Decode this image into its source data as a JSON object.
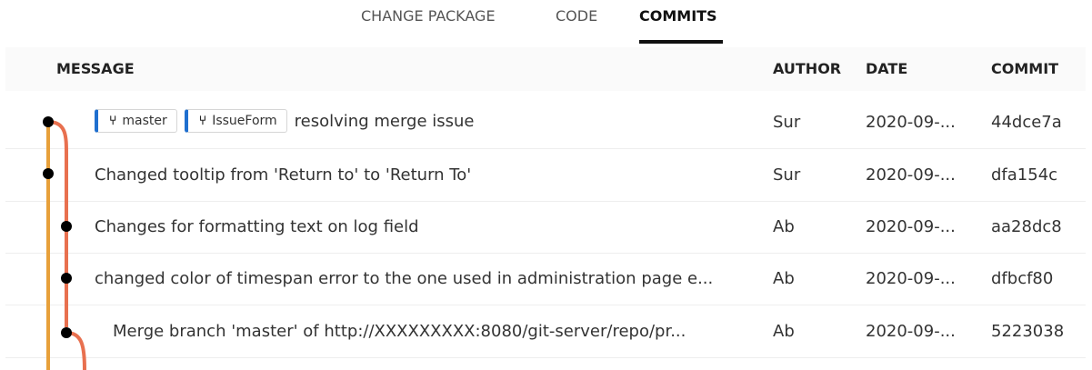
{
  "tabs": [
    {
      "label": "CHANGE PACKAGE",
      "active": false
    },
    {
      "label": "CODE",
      "active": false
    },
    {
      "label": "COMMITS",
      "active": true
    }
  ],
  "columns": {
    "message": "MESSAGE",
    "author": "AUTHOR",
    "date": "DATE",
    "commit": "COMMIT"
  },
  "rows": [
    {
      "refs": [
        {
          "label": "master"
        },
        {
          "label": "IssueForm"
        }
      ],
      "message": "resolving merge issue",
      "author": "Sur",
      "date": "2020-09-...",
      "commit": "44dce7a"
    },
    {
      "message": "Changed tooltip from 'Return to' to 'Return To'",
      "author": "Sur",
      "date": "2020-09-...",
      "commit": "dfa154c"
    },
    {
      "message": "Changes for formatting text on log field",
      "author": "Ab",
      "date": "2020-09-...",
      "commit": "aa28dc8"
    },
    {
      "message": "changed color of timespan error to the one used in administration page e...",
      "author": "Ab",
      "date": "2020-09-...",
      "commit": "dfbcf80"
    },
    {
      "message": "Merge branch 'master' of http://XXXXXXXXX:8080/git-server/repo/pr...",
      "author": "Ab",
      "date": "2020-09-...",
      "commit": "5223038"
    }
  ],
  "colors": {
    "graph_orange": "#e8a03a",
    "graph_coral": "#e8704f",
    "ref_accent": "#1f6fcf",
    "active_underline": "#111111"
  },
  "icons": {
    "ref_icon": "git-branch-icon"
  }
}
